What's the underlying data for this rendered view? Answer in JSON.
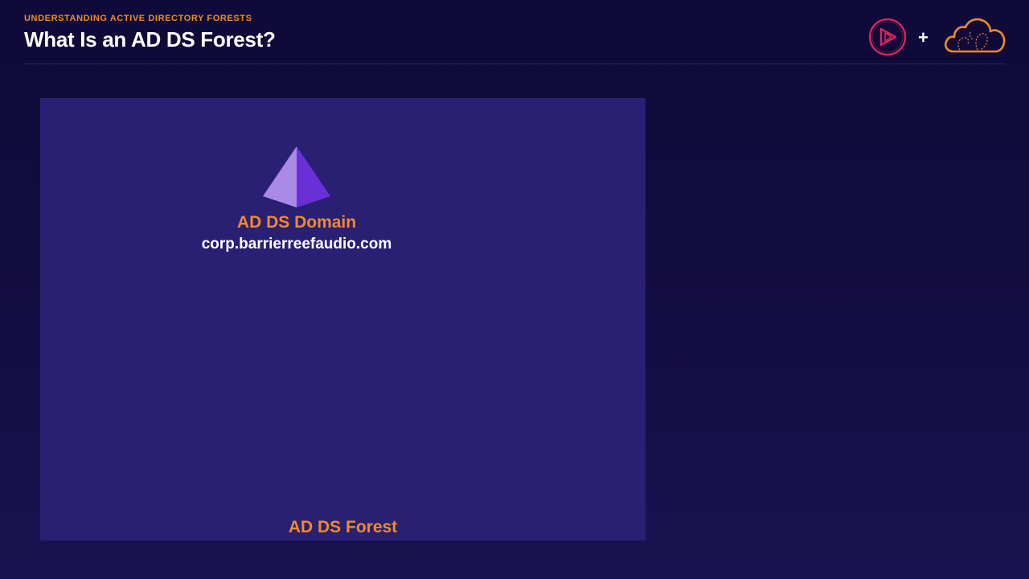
{
  "header": {
    "eyebrow": "UNDERSTANDING ACTIVE DIRECTORY FORESTS",
    "title": "What Is an AD DS Forest?"
  },
  "logos": {
    "left_icon": "play-logo-icon",
    "plus": "+",
    "right_icon": "cloud-logo-icon"
  },
  "diagram": {
    "domain": {
      "icon": "pyramid-icon",
      "label": "AD DS Domain",
      "name": "corp.barrierreefaudio.com"
    },
    "forest": {
      "label": "AD DS Forest"
    }
  },
  "colors": {
    "background": "#130c40",
    "accent": "#f08a2c",
    "forest_box": "#291f73",
    "pyramid_light": "#a98ae8",
    "pyramid_dark": "#6a30d8",
    "logo_play": "#e0245e",
    "logo_cloud": "#f08a2c"
  }
}
